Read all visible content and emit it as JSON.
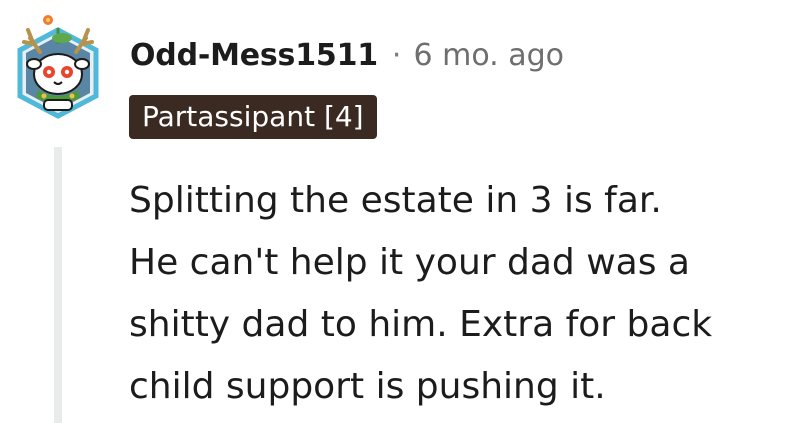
{
  "comment": {
    "username": "Odd-Mess1511",
    "separator": "·",
    "timestamp": "6 mo. ago",
    "flair": "Partassipant [4]",
    "body_lines": [
      "Splitting the estate in 3 is far.",
      "He can't help it your dad was a",
      "shitty dad to him. Extra for back",
      "child support is pushing it."
    ]
  }
}
